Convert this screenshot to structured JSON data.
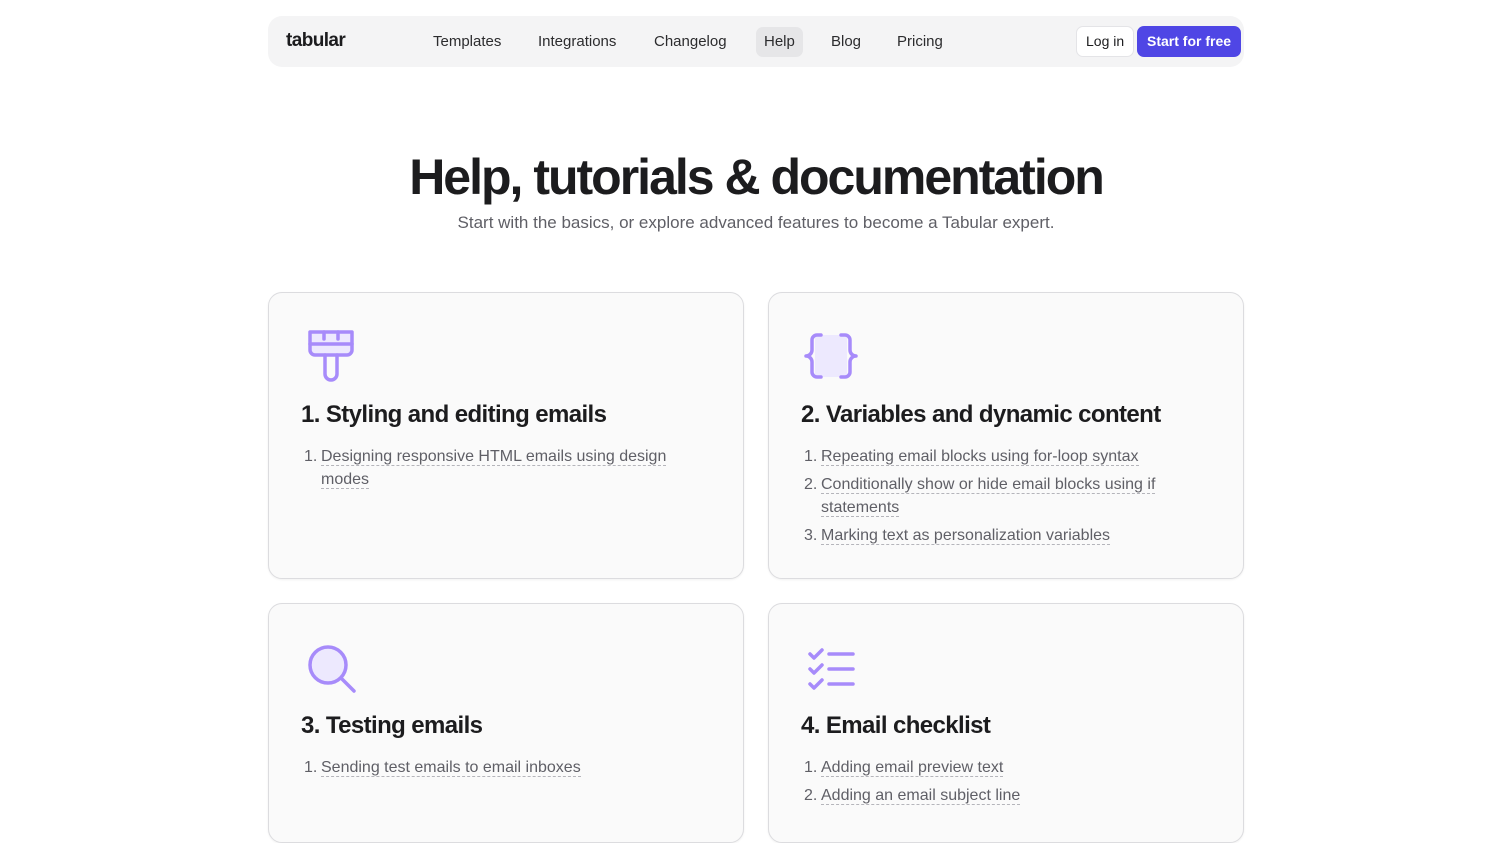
{
  "nav": {
    "logo": "tabular",
    "links": [
      {
        "label": "Templates"
      },
      {
        "label": "Integrations"
      },
      {
        "label": "Changelog"
      },
      {
        "label": "Help"
      },
      {
        "label": "Blog"
      },
      {
        "label": "Pricing"
      }
    ],
    "active_link": "Help",
    "login_label": "Log in",
    "start_label": "Start for free"
  },
  "hero": {
    "title": "Help, tutorials & documentation",
    "subtitle": "Start with the basics, or explore advanced features to become a Tabular expert."
  },
  "colors": {
    "accent": "#4f46e5",
    "icon": "#a78bfa"
  },
  "cards": [
    {
      "icon": "paint-brush-icon",
      "title": "1. Styling and editing emails",
      "items": [
        {
          "num": "1.",
          "label": "Designing responsive HTML emails using design modes"
        }
      ]
    },
    {
      "icon": "curly-braces-icon",
      "title": "2. Variables and dynamic content",
      "items": [
        {
          "num": "1.",
          "label": "Repeating email blocks using for-loop syntax"
        },
        {
          "num": "2.",
          "label": "Conditionally show or hide email blocks using if statements"
        },
        {
          "num": "3.",
          "label": "Marking text as personalization variables"
        }
      ]
    },
    {
      "icon": "magnifier-icon",
      "title": "3. Testing emails",
      "items": [
        {
          "num": "1.",
          "label": "Sending test emails to email inboxes"
        }
      ]
    },
    {
      "icon": "checklist-icon",
      "title": "4. Email checklist",
      "items": [
        {
          "num": "1.",
          "label": "Adding email preview text"
        },
        {
          "num": "2.",
          "label": "Adding an email subject line"
        }
      ]
    }
  ]
}
